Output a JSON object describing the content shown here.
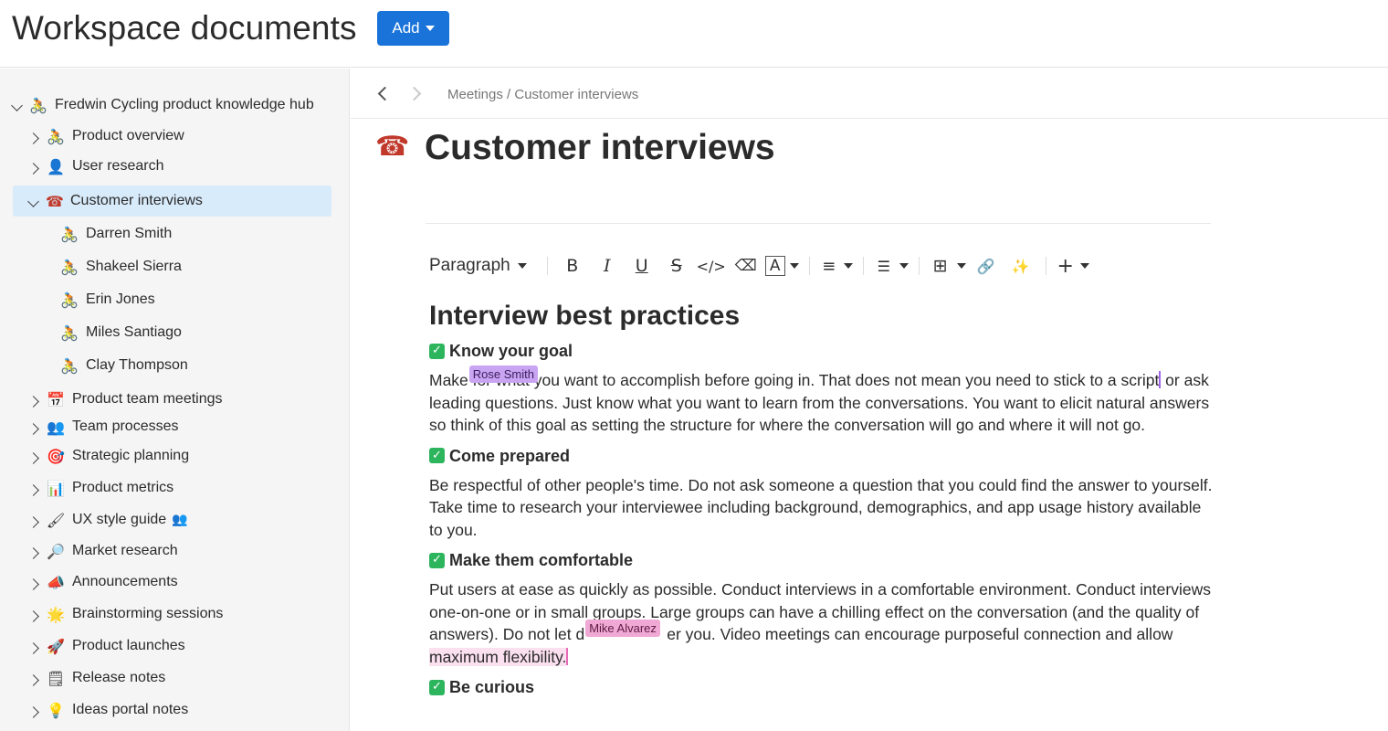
{
  "header": {
    "title": "Workspace documents",
    "add_label": "Add"
  },
  "sidebar": {
    "root": {
      "label": "Fredwin Cycling product knowledge hub",
      "icon": "cyclist-icon",
      "emoji": "🚴"
    },
    "items": [
      {
        "label": "Product overview",
        "emoji": "🚴",
        "icon": "cyclist-icon"
      },
      {
        "label": "User research",
        "emoji": "👤",
        "icon": "person-icon"
      },
      {
        "label": "Customer interviews",
        "emoji": "☎",
        "icon": "telephone-icon",
        "selected": true
      },
      {
        "label": "Darren Smith",
        "emoji": "🚴",
        "icon": "cyclist-icon"
      },
      {
        "label": "Shakeel Sierra",
        "emoji": "🚴",
        "icon": "cyclist-icon"
      },
      {
        "label": "Erin Jones",
        "emoji": "🚴",
        "icon": "cyclist-icon"
      },
      {
        "label": "Miles Santiago",
        "emoji": "🚴",
        "icon": "cyclist-icon"
      },
      {
        "label": "Clay Thompson",
        "emoji": "🚴",
        "icon": "cyclist-icon"
      },
      {
        "label": "Product team meetings",
        "emoji": "📅",
        "icon": "calendar-icon"
      },
      {
        "label": "Team processes",
        "emoji": "👥",
        "icon": "people-icon"
      },
      {
        "label": "Strategic planning",
        "emoji": "🎯",
        "icon": "target-icon"
      },
      {
        "label": "Product metrics",
        "emoji": "📊",
        "icon": "bar-chart-icon"
      },
      {
        "label": "UX style guide",
        "emoji": "🖌",
        "icon": "paintbrush-icon"
      },
      {
        "label": "Market research",
        "emoji": "🔎",
        "icon": "magnifier-icon"
      },
      {
        "label": "Announcements",
        "emoji": "📣",
        "icon": "megaphone-icon"
      },
      {
        "label": "Brainstorming sessions",
        "emoji": "🌟",
        "icon": "star-icon"
      },
      {
        "label": "Product launches",
        "emoji": "🚀",
        "icon": "rocket-icon"
      },
      {
        "label": "Release notes",
        "emoji": "🗒",
        "icon": "notepad-icon"
      },
      {
        "label": "Ideas portal notes",
        "emoji": "💡",
        "icon": "lightbulb-icon"
      }
    ]
  },
  "main": {
    "breadcrumb": "Meetings / Customer interviews",
    "page_emoji": "☎",
    "page_title": "Customer interviews",
    "toolbar": {
      "paragraph_label": "Paragraph",
      "bold": "B",
      "italic": "I",
      "underline": "U",
      "strike": "S",
      "code": "</>",
      "eraser": "⌫",
      "text_color": "A",
      "align": "≡",
      "list": "☰",
      "table": "⊞",
      "link": "🔗",
      "magic": "✨",
      "insert": "+"
    },
    "doc": {
      "heading": "Interview best practices",
      "sections": [
        {
          "title": "Know your goal",
          "pre": "Make",
          "mid": "for what you want to accomplish before going in. That does not mean you need to stick to a script",
          "post": " or ask leading questions. Just know what you want to learn from the conversations. You want to elicit natural answers so think of this goal as setting the structure for where the conversation will go and where it will not go."
        },
        {
          "title": "Come prepared",
          "text": "Be respectful of other people's time. Do not ask someone a question that you could find the answer to yourself. Take time to research your interviewee including background, demographics, and app usage history available to you."
        },
        {
          "title": "Make them comfortable",
          "pre": "Put users at ease as quickly as possible. Conduct interviews in a comfortable environment. Conduct interviews one-on-one or in small groups. Large groups can have a chilling effect on the conversation (and the quality of answers). Do not let d",
          "mid": "er you. Video meetings can encourage purposeful connection and allow ",
          "highlight": "maximum flexibility."
        },
        {
          "title": "Be curious"
        }
      ]
    },
    "collaborators": {
      "rose": "Rose Smith",
      "mike": "Mike Alvarez"
    }
  },
  "colors": {
    "accent": "#1a73d9",
    "selected_bg": "#d8ebfb",
    "rose_cursor": "#c9a4f2",
    "mike_cursor": "#f0a9d4",
    "check_green": "#2db55d"
  }
}
